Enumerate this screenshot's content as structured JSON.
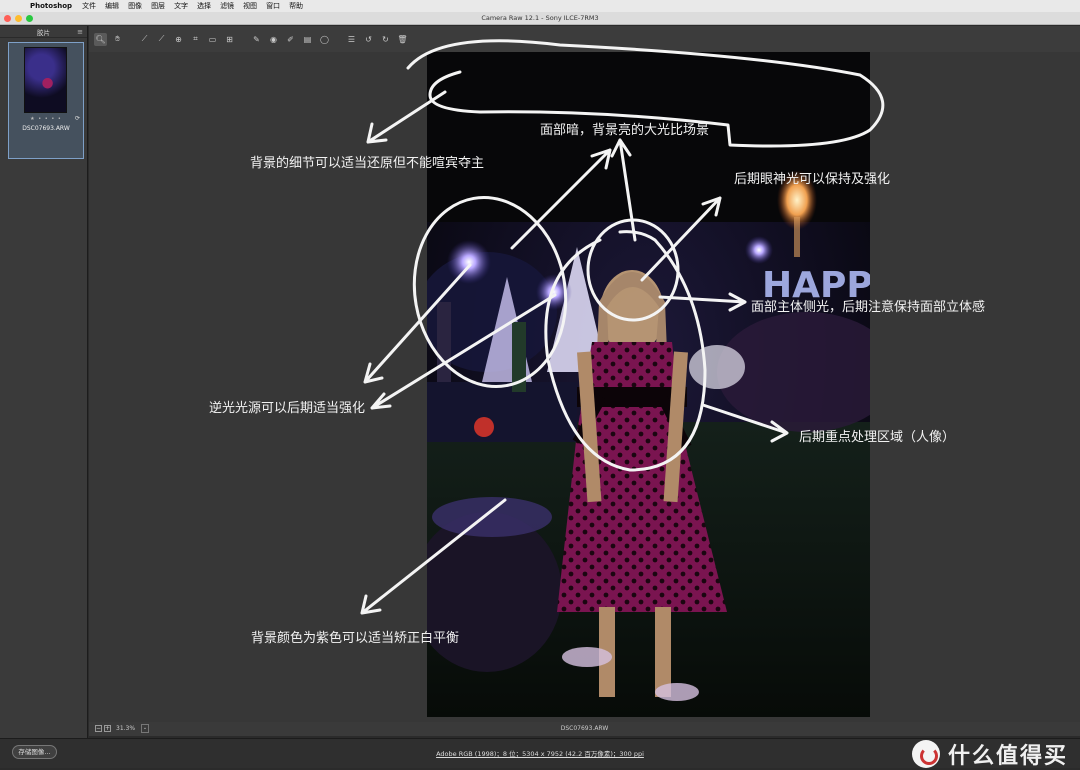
{
  "menubar": {
    "app_name": "Photoshop",
    "items": [
      "文件",
      "编辑",
      "图像",
      "图层",
      "文字",
      "选择",
      "滤镜",
      "视图",
      "窗口",
      "帮助"
    ]
  },
  "window": {
    "title": "Camera Raw 12.1 -  Sony ILCE-7RM3",
    "traffic_lights": [
      "#ff5f57",
      "#febc2e",
      "#28c840"
    ]
  },
  "filmstrip": {
    "header": "胶片",
    "thumbnail": {
      "stars": "★ • • • •",
      "filename": "DSC07693.ARW"
    }
  },
  "toolbar": {
    "tools": [
      {
        "icon": "zoom-icon",
        "glyph": "🔍︎",
        "active": true
      },
      {
        "icon": "hand-icon",
        "glyph": "✋︎"
      },
      {
        "icon": "white-balance-icon",
        "glyph": "⟋"
      },
      {
        "icon": "color-sampler-icon",
        "glyph": "⟋"
      },
      {
        "icon": "targeted-adjust-icon",
        "glyph": "⊕"
      },
      {
        "icon": "crop-icon",
        "glyph": "⌗"
      },
      {
        "icon": "straighten-icon",
        "glyph": "▭"
      },
      {
        "icon": "transform-icon",
        "glyph": "⊞"
      },
      {
        "icon": "spot-removal-icon",
        "glyph": "✎"
      },
      {
        "icon": "red-eye-icon",
        "glyph": "◉"
      },
      {
        "icon": "adjustment-brush-icon",
        "glyph": "✐"
      },
      {
        "icon": "graduated-filter-icon",
        "glyph": "▤"
      },
      {
        "icon": "radial-filter-icon",
        "glyph": "◯"
      },
      {
        "icon": "preferences-icon",
        "glyph": "☰"
      },
      {
        "icon": "rotate-left-icon",
        "glyph": "↺"
      },
      {
        "icon": "rotate-right-icon",
        "glyph": "↻"
      },
      {
        "icon": "trash-icon",
        "glyph": "🗑︎"
      }
    ]
  },
  "zoombar": {
    "zoom_out": "−",
    "zoom_in": "+",
    "zoom_level": "31.3%",
    "dropdown": "⌄",
    "filename": "DSC07693.ARW"
  },
  "footer": {
    "save_label": "存储图像...",
    "workflow_info": "Adobe RGB (1998)；8 位；5304 x 7952 (42.2 百万像素)；300 ppi"
  },
  "watermark": {
    "text": "什么值得买"
  },
  "annotations": [
    "面部暗，背景亮的大光比场景",
    "背景的细节可以适当还原但不能喧宾夺主",
    "后期眼神光可以保持及强化",
    "面部主体侧光，后期注意保持面部立体感",
    "逆光光源可以后期适当强化",
    "后期重点处理区域（人像）",
    "背景颜色为紫色可以适当矫正白平衡"
  ],
  "photo_text": "HAPPY"
}
